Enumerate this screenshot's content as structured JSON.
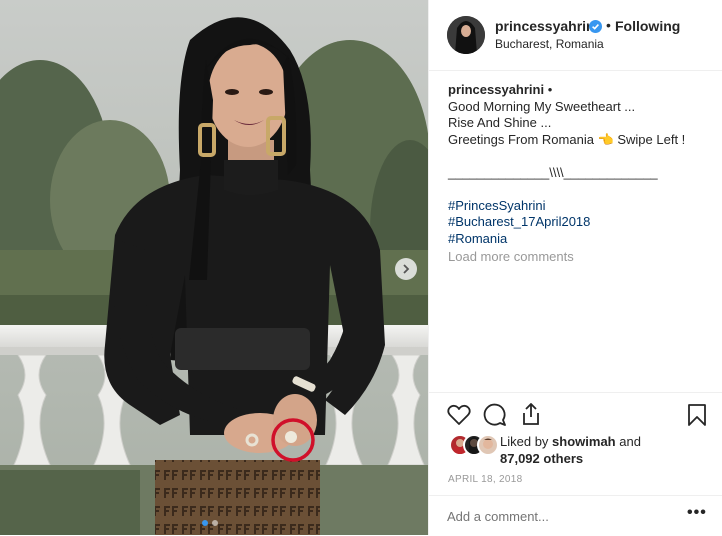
{
  "post": {
    "username": "princessyahrini",
    "verified": true,
    "separator": "•",
    "follow_label": "Following",
    "location": "Bucharest, Romania"
  },
  "caption": {
    "username": "princessyahrini",
    "bullet": "•",
    "lines": [
      "Good Morning My Sweetheart ...",
      "Rise And Shine ...",
      "Greetings From Romania 👈 Swipe Left !",
      "",
      "______________\\\\\\\\_____________",
      ""
    ],
    "hashtags": [
      "#PrincesSyahrini",
      "#Bucharest_17April2018",
      "#Romania"
    ]
  },
  "load_more_label": "Load more comments",
  "likes": {
    "prefix": "Liked by",
    "user": "showimah",
    "and": "and",
    "count": "87,092 others"
  },
  "date": "APRIL 18, 2018",
  "comment": {
    "placeholder": "Add a comment..."
  },
  "more_label": "•••",
  "carousel": {
    "total": 2,
    "current": 1
  },
  "icons": {
    "like": "heart-icon",
    "comment": "comment-bubble-icon",
    "share": "share-icon",
    "save": "bookmark-icon",
    "verified": "verified-badge-icon",
    "next": "chevron-right-icon"
  },
  "colors": {
    "link": "#003569",
    "verified": "#3897f0",
    "muted": "#999999",
    "highlight_circle": "#d0102a"
  }
}
